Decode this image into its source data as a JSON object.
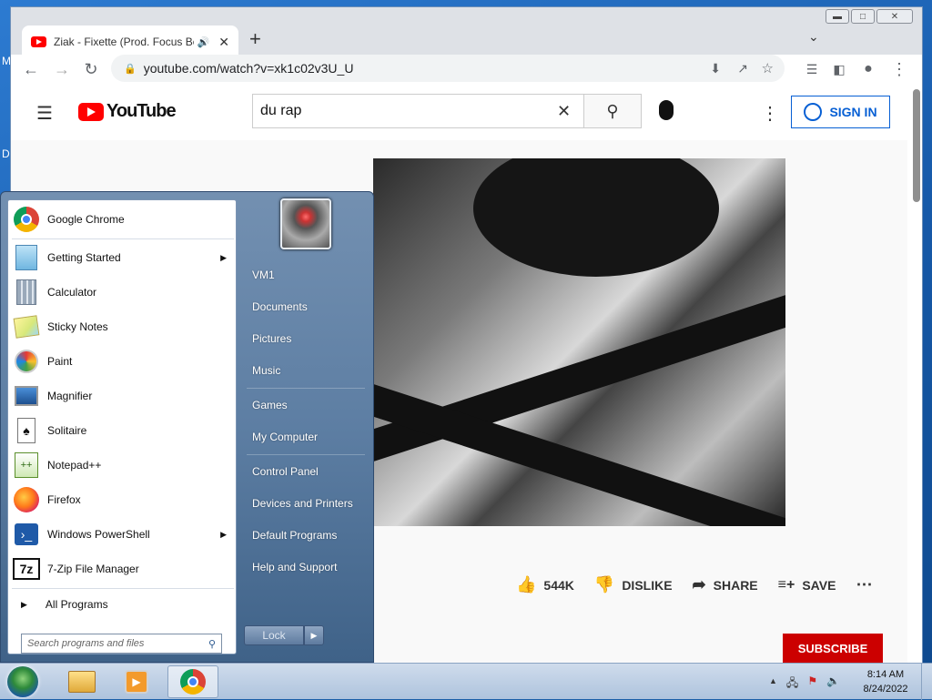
{
  "desktop": {
    "edge_text_1": "M",
    "edge_text_2": "D"
  },
  "browser": {
    "tab_title": "Ziak - Fixette (Prod. Focus Be",
    "url": "youtube.com/watch?v=xk1c02v3U_U",
    "new_tab": "+",
    "window_controls": [
      "minimize",
      "maximize",
      "close"
    ]
  },
  "youtube": {
    "logo_text": "YouTube",
    "search_value": "du rap",
    "sign_in": "SIGN IN",
    "actions": {
      "likes": "544K",
      "dislike": "DISLIKE",
      "share": "SHARE",
      "save": "SAVE"
    },
    "subscribe": "SUBSCRIBE"
  },
  "start_menu": {
    "pinned": [
      {
        "label": "Google Chrome",
        "icon": "chrome-icon"
      },
      {
        "label": "Getting Started",
        "icon": "getting-started-icon",
        "has_submenu": true
      },
      {
        "label": "Calculator",
        "icon": "calculator-icon"
      },
      {
        "label": "Sticky Notes",
        "icon": "sticky-notes-icon"
      },
      {
        "label": "Paint",
        "icon": "paint-icon"
      },
      {
        "label": "Magnifier",
        "icon": "magnifier-icon"
      },
      {
        "label": "Solitaire",
        "icon": "solitaire-icon"
      },
      {
        "label": "Notepad++",
        "icon": "notepadpp-icon"
      },
      {
        "label": "Firefox",
        "icon": "firefox-icon"
      },
      {
        "label": "Windows PowerShell",
        "icon": "powershell-icon",
        "has_submenu": true
      },
      {
        "label": "7-Zip File Manager",
        "icon": "7zip-icon"
      }
    ],
    "all_programs": "All Programs",
    "search_placeholder": "Search programs and files",
    "right_items": [
      "VM1",
      "Documents",
      "Pictures",
      "Music",
      "Games",
      "My Computer",
      "Control Panel",
      "Devices and Printers",
      "Default Programs",
      "Help and Support"
    ],
    "lock_label": "Lock"
  },
  "taskbar": {
    "time": "8:14 AM",
    "date": "8/24/2022"
  }
}
